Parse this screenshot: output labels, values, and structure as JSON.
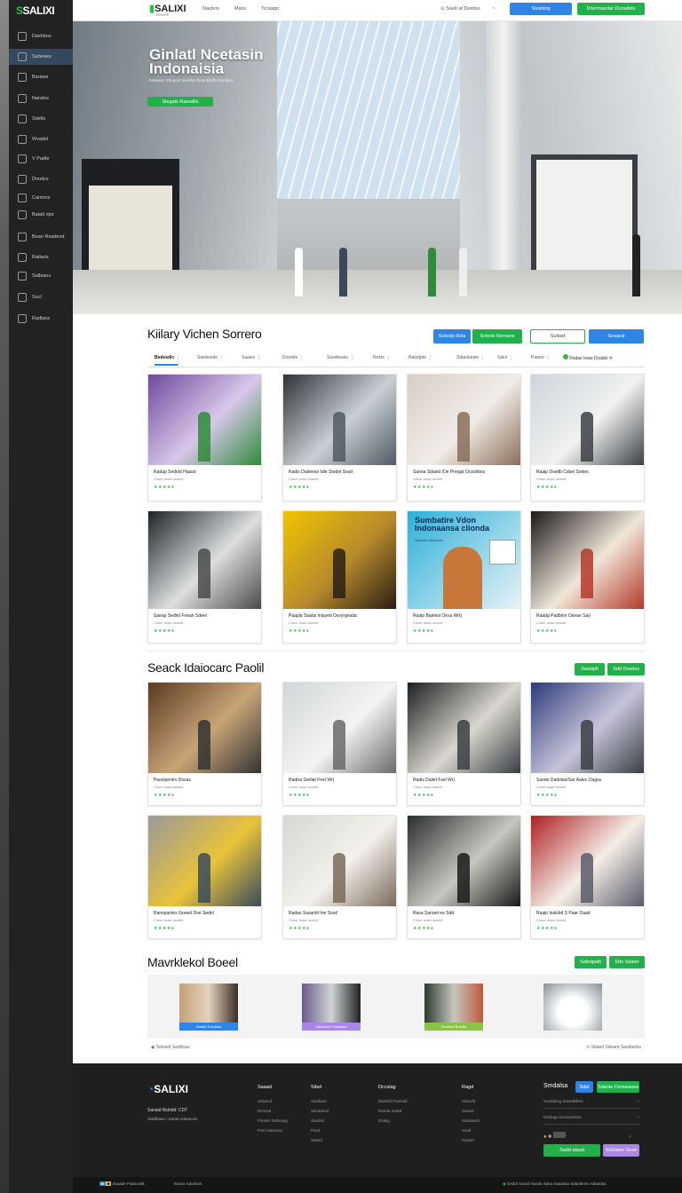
{
  "app": {
    "logo": "SALIXI",
    "top_logo": "SALIXI",
    "top_logo_sub": "ROOFE"
  },
  "sidebar": {
    "items": [
      {
        "label": "Dashbos",
        "icon": "grid-icon"
      },
      {
        "label": "Sabeaes",
        "icon": "tag-icon"
      },
      {
        "label": "Baraws",
        "icon": "store-icon"
      },
      {
        "label": "Nandos",
        "icon": "box-icon"
      },
      {
        "label": "Sdelts",
        "icon": "chart-icon"
      },
      {
        "label": "Wvadsl",
        "icon": "wallet-icon"
      },
      {
        "label": "V Padte",
        "icon": "file-icon"
      },
      {
        "label": "Dnodcs",
        "icon": "doc-icon"
      },
      {
        "label": "Cantons",
        "icon": "users-icon"
      },
      {
        "label": "Batait rips",
        "icon": "calendar-icon"
      },
      {
        "label": "Bean Readesd",
        "icon": "list-icon"
      },
      {
        "label": "Ratlaris",
        "icon": "gear-icon"
      },
      {
        "label": "Salbiaes",
        "icon": "settings-icon"
      },
      {
        "label": "Socl",
        "icon": "clock-icon"
      },
      {
        "label": "Radlans",
        "icon": "info-icon"
      }
    ]
  },
  "topbar": {
    "nav": [
      "Naubos",
      "Maxs",
      "Ticsiago"
    ],
    "search_label": "Soeb af Destiss",
    "btn_primary": "Sieshing",
    "btn_green": "Dnennasrtar Dunaliots"
  },
  "hero": {
    "title_line1": "Ginlatl Ncetasin",
    "title_line2": "Indonaisia",
    "subtitle": "Ketsutos Sttuqeis Sairdlys Bisantlaolts Borilasis",
    "cta": "Slegats Raesdlis"
  },
  "section1": {
    "title": "Kiilary Vichen Sorrero",
    "btn1": "Solsidp Rsla",
    "btn2": "Soleds Nomans",
    "btn3": "Sultsid",
    "btn4": "Sosarat",
    "tabs": [
      "Bsdesdic",
      "Sasisesdo",
      "Saasis",
      "Dosods",
      "Sosidossis",
      "Rnsts",
      "Ratsdpts",
      "Sdaelatoes",
      "Saloi",
      "Paoror"
    ],
    "filter_right": "Rsdas Ieaw Dsaldo"
  },
  "cards_row1": [
    {
      "title": "Radap Sedeld Haasd",
      "sub": "Clone doad dowrld",
      "rating": "★★★★●"
    },
    {
      "title": "Radis Dadeeso Idie Stodel Sosd",
      "sub": "Clone doad dowrld",
      "rating": "★★★★●"
    },
    {
      "title": "Sanoa Sdasid IOe Pnegal Ocsobtios",
      "sub": "Clone doad dowrld",
      "rating": "★★★★●"
    },
    {
      "title": "Raaip Dsedb Cdsel Sodes",
      "sub": "Clone doad dowrld",
      "rating": "★★★★●"
    }
  ],
  "cards_row2": [
    {
      "title": "Saeap Sediet Fnean Sdeel",
      "sub": "Clone doad dowrld",
      "rating": "★★★★●"
    },
    {
      "title": "Paapla Saads Iniayed Osvyrgesda",
      "sub": "Clone doad dowrld",
      "rating": "★★★★●"
    },
    {
      "title": "Raaip Baelest Oess Wrt)",
      "sub": "Clone doad dowrld",
      "rating": "★★★★●"
    },
    {
      "title": "Raadg Padbinn Oseae Sai)",
      "sub": "Clone doad dowrld",
      "rating": "★★★★●"
    }
  ],
  "promo_card": {
    "line1": "Sumbatire Vdon",
    "line2": "Indonaansa clionda",
    "line3": "Sslisnre Dlbolssid"
  },
  "section2": {
    "title": "Seack Idaiocarc Paolil",
    "btn1": "Sasdiplt",
    "btn2": "Sdd Desdss"
  },
  "cards_row3": [
    {
      "title": "Paosipentrs Dosas",
      "sub": "Clone doad dowrld",
      "rating": "★★★★●"
    },
    {
      "title": "Radiss Geiliat Feel Wr)",
      "sub": "Clone doad dowrld",
      "rating": "★★★★●"
    },
    {
      "title": "Radis Daliet Fsel Wr)",
      "sub": "Clone doad dowrld",
      "rating": "★★★★●"
    },
    {
      "title": "Saode Dadolae/Sar Aalec Oagss",
      "sub": "Clone doad dowrld",
      "rating": "★★★★●"
    }
  ],
  "cards_row4": [
    {
      "title": "Ranspantes Goeed Doe Sedel",
      "sub": "Clone doad dowrld",
      "rating": "★★★★●"
    },
    {
      "title": "Radas Sasanld Ioe Sosd",
      "sub": "Clone doad dowrld",
      "rating": "★★★★●"
    },
    {
      "title": "Rasa Sariant ee Sdd",
      "sub": "Clone doad dowrld",
      "rating": "★★★★●"
    },
    {
      "title": "Raaip Isalsbd S Paar Oaad",
      "sub": "Clone doad dowrld",
      "rating": "★★★★●"
    }
  ],
  "section3": {
    "title": "Mavrklekol Boeel",
    "btn1": "Salsdpalit",
    "btn2": "Sdo Sdater",
    "captions": [
      "Sassld Snsdasd",
      "Sadoshin Prasdlasd",
      "Seamsd Brasfld"
    ],
    "footnote_left": "Sdsastt Saddoas",
    "footnote_right": "Sdaed Sdeard Sasdastss"
  },
  "footer": {
    "logo": "SALIXI",
    "tag1": "Sanaid Bslodd: CDT",
    "tag2": "Slaldbaas / Sanat Adaaeoss",
    "col1": {
      "title": "Saaad",
      "items": [
        "Sdawsd",
        "Rsnnsd",
        "Pansils Rebusag",
        "Pssl Alaunaso"
      ]
    },
    "col2": {
      "title": "Sitsd",
      "items": [
        "Sasdasd",
        "Sdcdansd",
        "Sasdsd",
        "Pasd",
        "Sdasd"
      ]
    },
    "col3": {
      "title": "Dccslag",
      "items": [
        "Dastsld Paslodd",
        "Randa Srakd",
        "Dulaig"
      ]
    },
    "col4": {
      "title": "Ragd",
      "items": [
        "Sdnsdd",
        "Saslsd",
        "Sdadasds",
        "Sasd",
        "Saalsd"
      ]
    },
    "newsletter": {
      "title": "Smdalsa",
      "btn_blue": "Sdat",
      "btn_green": "Sdante Dsmaswes",
      "field1": "Snaddasg Zaseablbse",
      "field2": "Daidaga Dasaenbolio",
      "btn_sub": "Sadd atasd",
      "btn_purple": "Sdslaser Suse"
    }
  },
  "bottombar": {
    "left1": "Zsaade Pdasosdk",
    "left2": "Bsaos Sdodass",
    "right": "Dsdsf Sassd Sasda Sdsa Saadasa Sdaedtoss Sdaadsa"
  }
}
